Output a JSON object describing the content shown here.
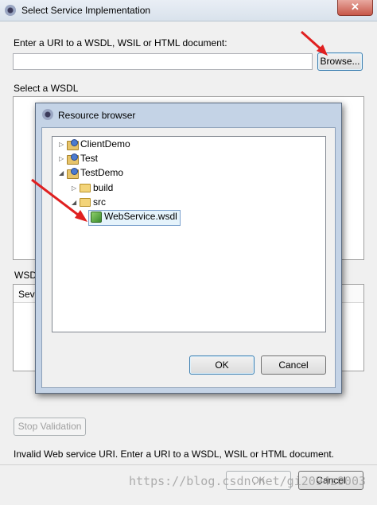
{
  "window": {
    "title": "Select Service Implementation",
    "close_glyph": "✕"
  },
  "uri_section": {
    "label": "Enter a URI to a WSDL, WSIL or HTML document:",
    "input_value": "",
    "browse_label": "Browse..."
  },
  "wsdl_section": {
    "label": "Select a WSDL",
    "wsdl_label_partial": "WSDI",
    "table_header_partial": "Seve"
  },
  "resource_browser": {
    "title": "Resource browser",
    "tree": [
      {
        "label": "ClientDemo",
        "type": "project",
        "expanded": false,
        "level": 0
      },
      {
        "label": "Test",
        "type": "project",
        "expanded": false,
        "level": 0
      },
      {
        "label": "TestDemo",
        "type": "project",
        "expanded": true,
        "level": 0
      },
      {
        "label": "build",
        "type": "folder",
        "expanded": false,
        "level": 1
      },
      {
        "label": "src",
        "type": "folder",
        "expanded": true,
        "level": 1
      },
      {
        "label": "WebService.wsdl",
        "type": "wsdl",
        "selected": true,
        "level": 2
      }
    ],
    "ok_label": "OK",
    "cancel_label": "Cancel"
  },
  "footer": {
    "stop_validation_label": "Stop Validation",
    "status_message": "Invalid Web service URI.  Enter a URI to a WSDL, WSIL or HTML document.",
    "ok_label": "OK",
    "cancel_label": "Cancel",
    "watermark": "https://blog.csdn.net/gi2094z0003"
  },
  "colors": {
    "annotation_arrow": "#e02020",
    "selection": "#e5f3fb"
  }
}
